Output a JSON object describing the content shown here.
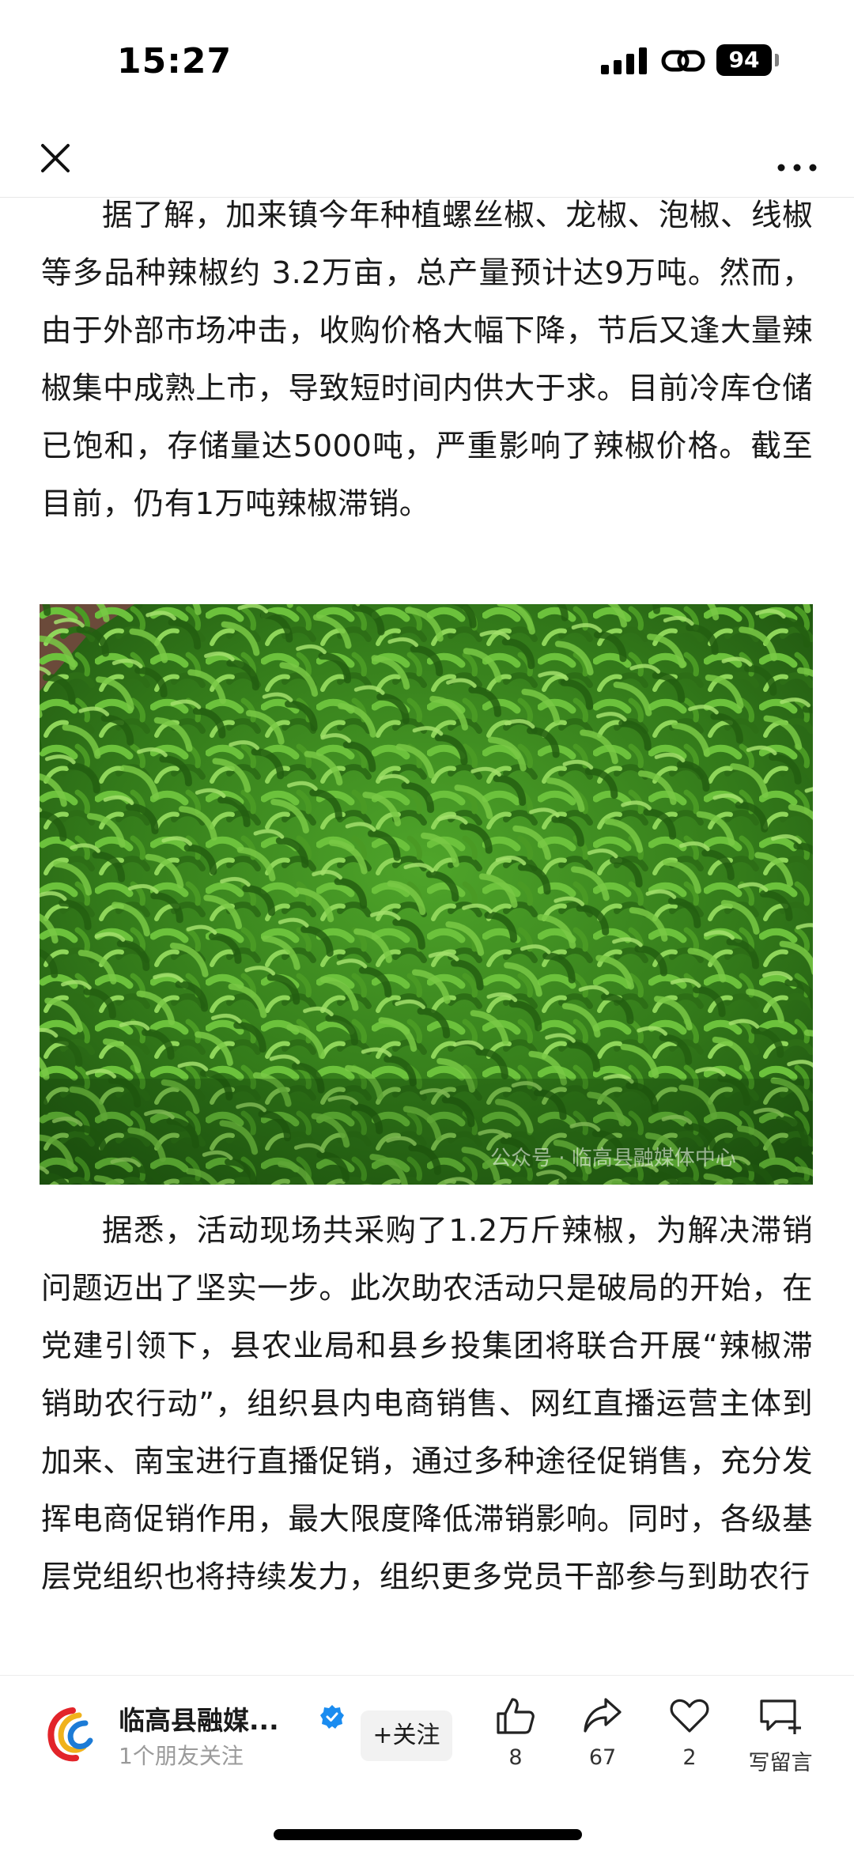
{
  "status_bar": {
    "time": "15:27",
    "battery": "94"
  },
  "nav": {
    "close_icon": "close-icon",
    "more_icon": "more-icon"
  },
  "article": {
    "paragraph_1": "据了解，加来镇今年种植螺丝椒、龙椒、泡椒、线椒等多品种辣椒约 3.2万亩，总产量预计达9万吨。然而，由于外部市场冲击，收购价格大幅下降，节后又逢大量辣椒集中成熟上市，导致短时间内供大于求。目前冷库仓储已饱和，存储量达5000吨，严重影响了辣椒价格。截至目前，仍有1万吨辣椒滞销。",
    "image_watermark": "公众号 · 临高县融媒体中心",
    "paragraph_2": "据悉，活动现场共采购了1.2万斤辣椒，为解决滞销问题迈出了坚实一步。此次助农活动只是破局的开始，在党建引领下，县农业局和县乡投集团将联合开展“辣椒滞销助农行动”，组织县内电商销售、网红直播运营主体到加来、南宝进行直播促销，通过多种途径促销售，充分发挥电商促销作用，最大限度降低滞销影响。同时，各级基层党组织也将持续发力，组织更多党员干部参与到助农行"
  },
  "bottom_bar": {
    "account_name": "临高县融媒...",
    "follower_note": "1个朋友关注",
    "follow_label": "+关注",
    "like_count": "8",
    "share_count": "67",
    "favorite_count": "2",
    "comment_label": "写留言"
  },
  "colors": {
    "verified_blue": "#1a8cf0",
    "pepper_green": "#3b8f1f"
  }
}
